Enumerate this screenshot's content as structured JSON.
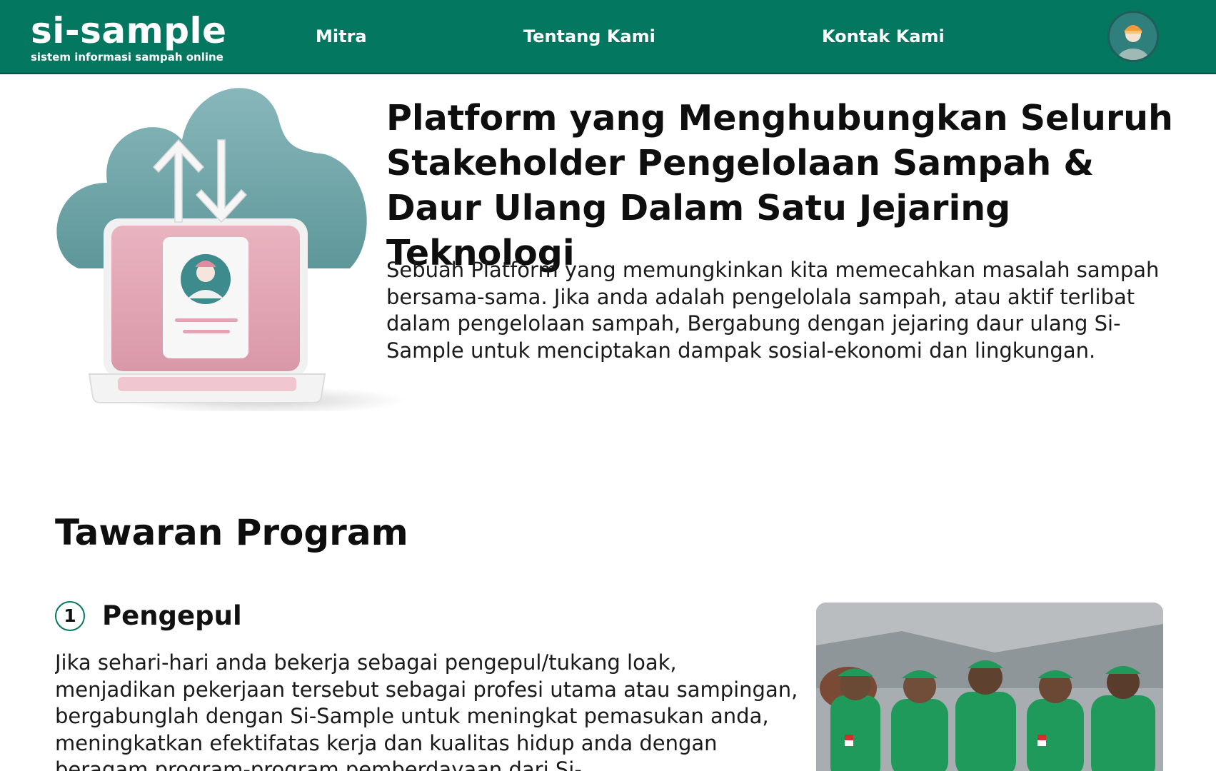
{
  "header": {
    "brand_name": "si-sample",
    "brand_tagline": "sistem informasi sampah online",
    "nav": {
      "mitra": "Mitra",
      "tentang": "Tentang Kami",
      "kontak": "Kontak Kami"
    },
    "avatar_icon": "user-avatar-icon",
    "bg_color": "#037760"
  },
  "hero": {
    "illustration_icon": "cloud-laptop-sync-icon",
    "title": "Platform yang Menghubungkan Seluruh Stakeholder Pengelolaan Sampah & Daur Ulang Dalam Satu Jejaring Teknologi",
    "description": "Sebuah Platform yang memungkinkan kita memecahkan masalah sampah bersama-sama. Jika anda adalah pengelolala sampah, atau aktif terlibat dalam pengelolaan sampah, Bergabung dengan jejaring daur ulang Si-Sample untuk menciptakan dampak sosial-ekonomi dan lingkungan."
  },
  "programs": {
    "section_title": "Tawaran Program",
    "items": [
      {
        "number": "1",
        "title": "Pengepul",
        "description": "Jika sehari-hari anda bekerja sebagai pengepul/tukang loak, menjadikan pekerjaan tersebut sebagai profesi utama atau sampingan, bergabunglah dengan Si-Sample untuk meningkat pemasukan anda, meningkatkan efektifatas kerja dan kualitas hidup anda dengan beragam program-program pemberdayaan dari Si-",
        "photo_icon": "collectors-group-photo"
      }
    ]
  }
}
